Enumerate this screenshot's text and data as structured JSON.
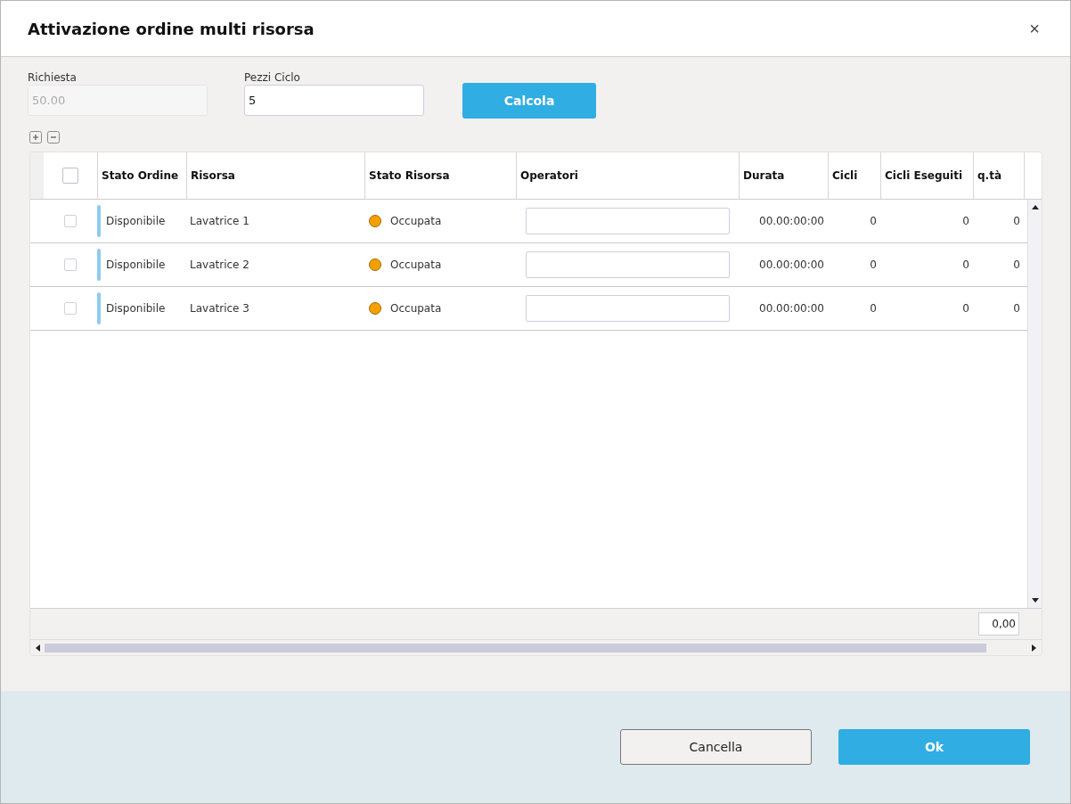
{
  "dialog": {
    "title": "Attivazione ordine multi risorsa",
    "close": "×"
  },
  "fields": [
    {
      "label": "Richiesta",
      "value": "50.00",
      "disabled": true
    },
    {
      "label": "Pezzi Ciclo",
      "value": "5",
      "disabled": false
    }
  ],
  "calculate_button": "Calcola",
  "table": {
    "select_all": {
      "checked": false
    },
    "columns": [
      "Stato Ordine",
      "Risorsa",
      "Stato Risorsa",
      "Operatori",
      "Durata",
      "Cicli",
      "Cicli Eseguiti",
      "q.tà"
    ],
    "rows": [
      {
        "checked": false,
        "order_state": "Disponibile",
        "resource": "Lavatrice 1",
        "resource_state": "Occupata",
        "duration": "00.00:00:00",
        "cycles": "0",
        "cycles_done": "0",
        "qty": "0"
      },
      {
        "checked": false,
        "order_state": "Disponibile",
        "resource": "Lavatrice 2",
        "resource_state": "Occupata",
        "duration": "00.00:00:00",
        "cycles": "0",
        "cycles_done": "0",
        "qty": "0"
      },
      {
        "checked": false,
        "order_state": "Disponibile",
        "resource": "Lavatrice 3",
        "resource_state": "Occupata",
        "duration": "00.00:00:00",
        "cycles": "0",
        "cycles_done": "0",
        "qty": "0"
      }
    ],
    "total": "0,00"
  },
  "buttons": [
    {
      "label": "Cancella",
      "kind": "secondary"
    },
    {
      "label": "Ok",
      "kind": "primary"
    }
  ]
}
